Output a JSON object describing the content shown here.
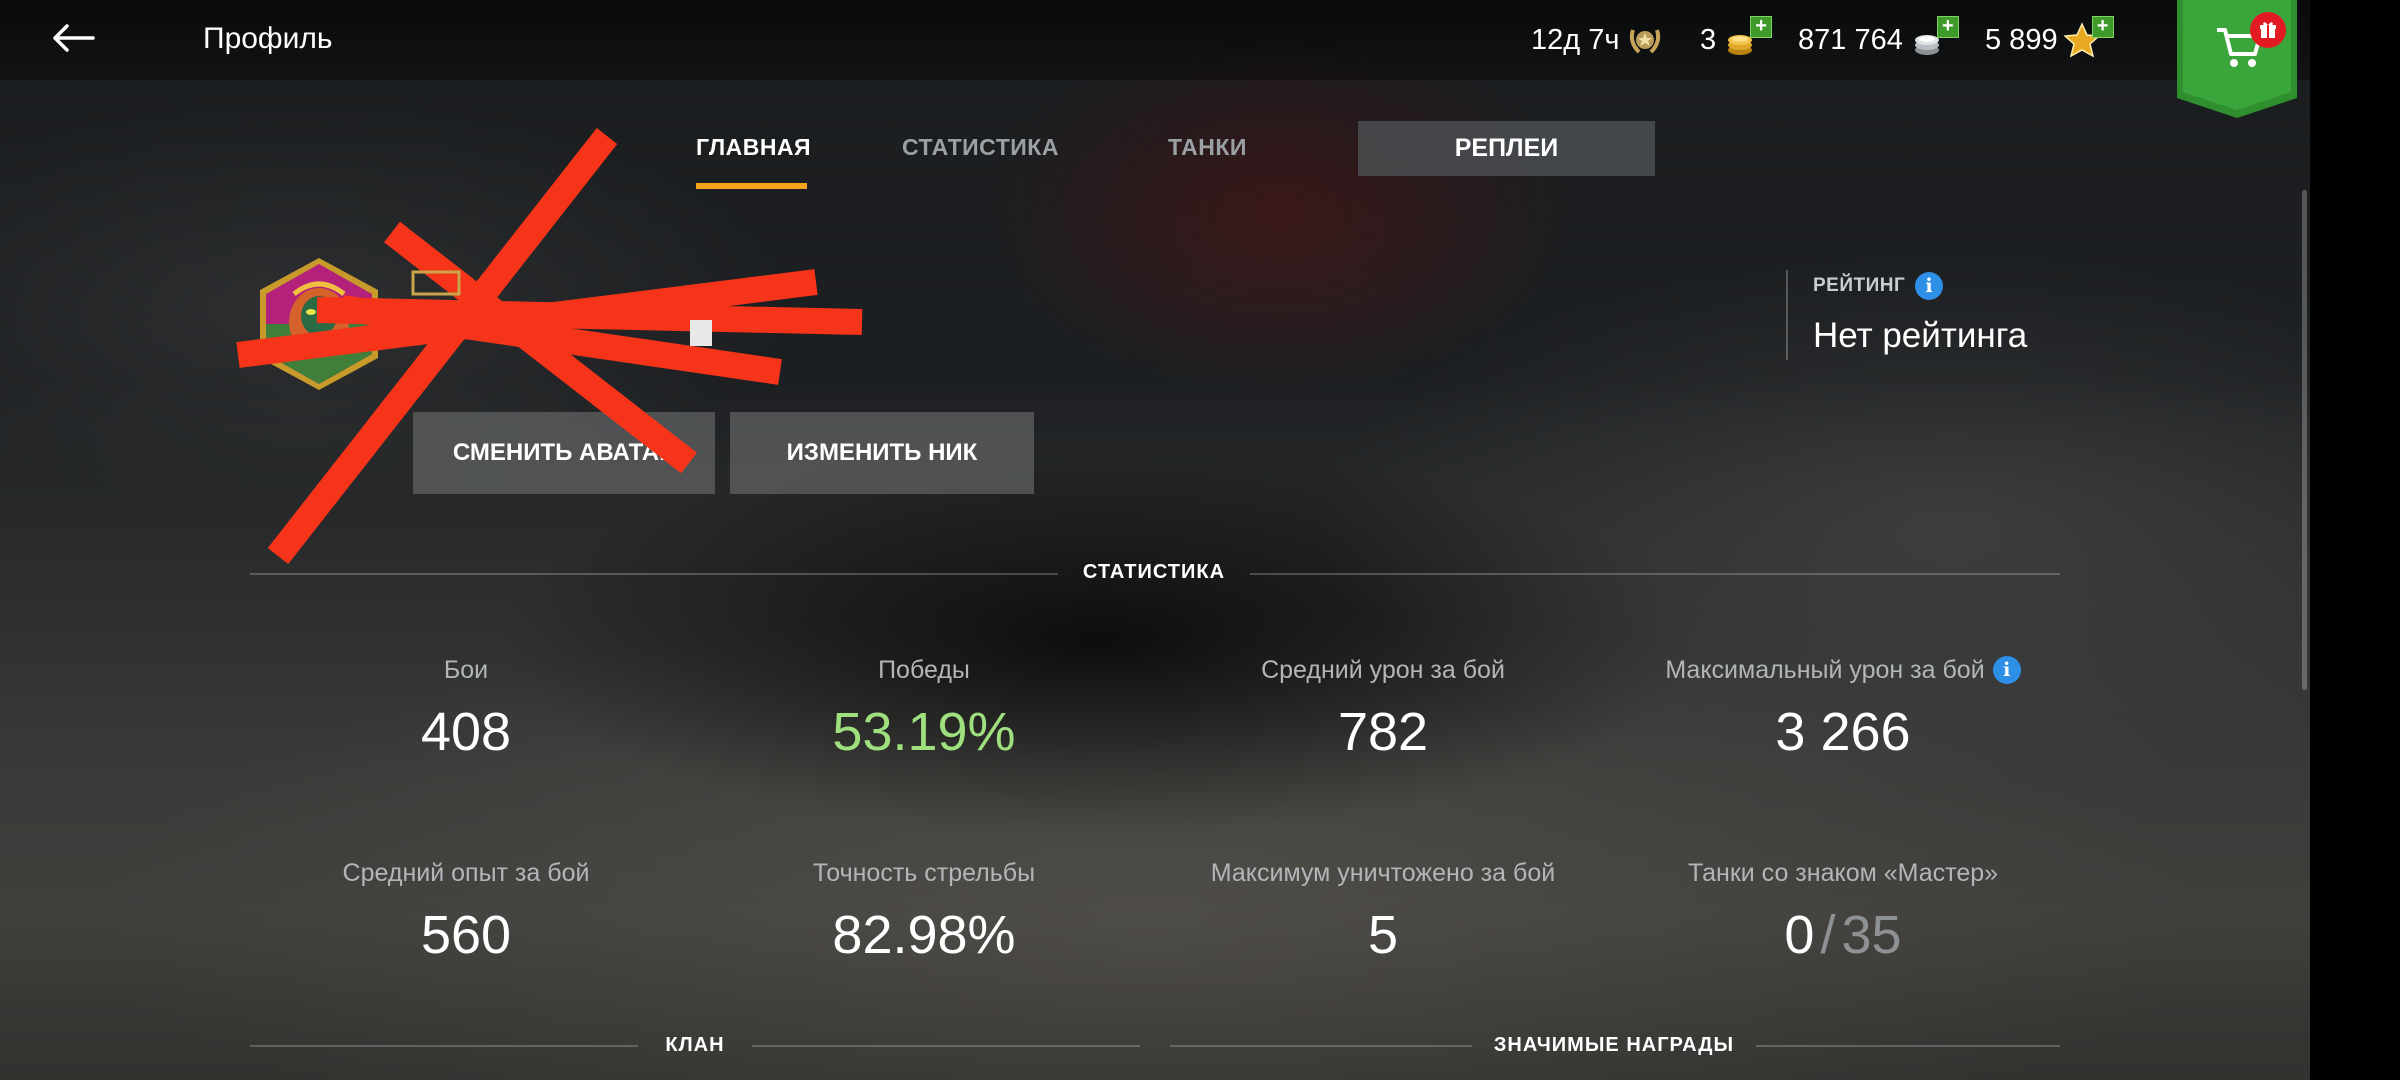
{
  "header": {
    "title": "Профиль",
    "currencies": [
      {
        "name": "premium-time",
        "value": "12д 7ч"
      },
      {
        "name": "gold",
        "value": "3"
      },
      {
        "name": "credits",
        "value": "871 764"
      },
      {
        "name": "free-xp",
        "value": "5 899"
      }
    ]
  },
  "tabs": [
    {
      "label": "ГЛАВНАЯ",
      "active": true
    },
    {
      "label": "СТАТИСТИКА",
      "active": false
    },
    {
      "label": "ТАНКИ",
      "active": false
    },
    {
      "label": "РЕПЛЕИ",
      "active": false
    }
  ],
  "profile": {
    "change_avatar_label": "СМЕНИТЬ АВАТАР",
    "change_nick_label": "ИЗМЕНИТЬ НИК"
  },
  "rating": {
    "label": "РЕЙТИНГ",
    "value": "Нет рейтинга"
  },
  "stats": {
    "section_title": "СТАТИСТИКА",
    "items": [
      {
        "label": "Бои",
        "value": "408"
      },
      {
        "label": "Победы",
        "value": "53.19%"
      },
      {
        "label": "Средний урон за бой",
        "value": "782"
      },
      {
        "label": "Максимальный урон за бой",
        "value": "3 266"
      },
      {
        "label": "Средний опыт за бой",
        "value": "560"
      },
      {
        "label": "Точность стрельбы",
        "value": "82.98%"
      },
      {
        "label": "Максимум уничтожено за бой",
        "value": "5"
      },
      {
        "label": "Танки со знаком «Мастер»",
        "value": "0",
        "total": "35"
      }
    ]
  },
  "sections": {
    "clan_title": "КЛАН",
    "awards_title": "ЗНАЧИМЫЕ НАГРАДЫ"
  },
  "colors": {
    "accent": "#f4a21c",
    "win_green": "#9ee07e",
    "info_blue": "#2e8fe6",
    "shop_green": "#2f8f2f",
    "redaction_red": "#f5341a"
  },
  "icons": {
    "back": "arrow-left-icon",
    "premium": "laurel-badge-icon",
    "gold": "gold-coins-icon",
    "credits": "silver-coins-icon",
    "free_xp": "star-xp-icon",
    "shop": "shopping-cart-icon",
    "gift": "gift-icon",
    "info": "info-icon"
  }
}
